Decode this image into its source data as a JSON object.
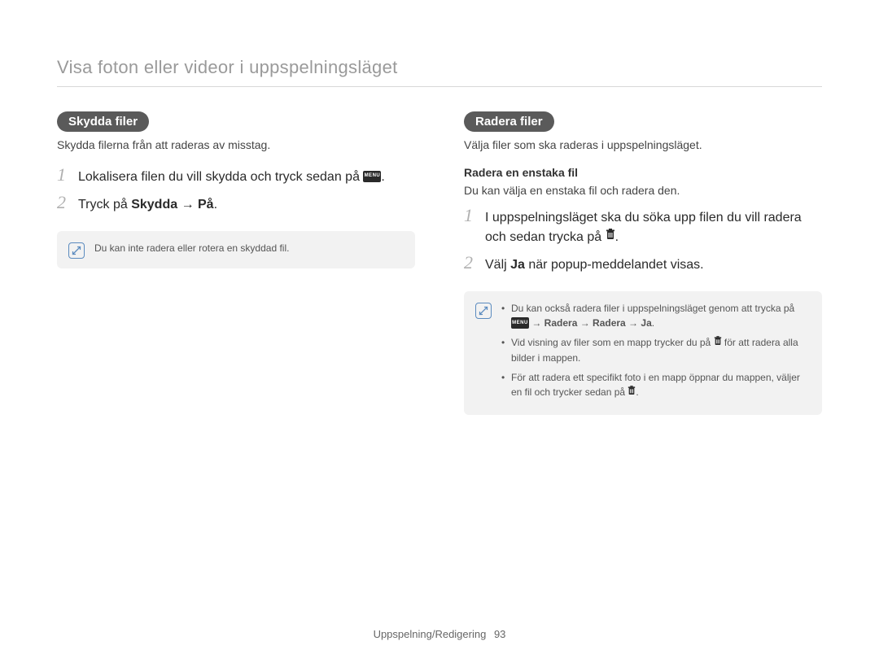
{
  "header": "Visa foton eller videor i uppspelningsläget",
  "left": {
    "pill": "Skydda filer",
    "intro": "Skydda filerna från att raderas av misstag.",
    "step1_pre": "Lokalisera filen du vill skydda och tryck sedan på ",
    "step1_post": ".",
    "step2_pre": "Tryck på ",
    "step2_bold": "Skydda → På",
    "step2_post": ".",
    "note": "Du kan inte radera eller rotera en skyddad fil."
  },
  "right": {
    "pill": "Radera filer",
    "intro": "Välja filer som ska raderas i uppspelningsläget.",
    "subhead": "Radera en enstaka fil",
    "body": "Du kan välja en enstaka fil och radera den.",
    "step1_a": "I uppspelningsläget ska du söka upp filen du vill radera och sedan trycka på ",
    "step1_b": ".",
    "step2_pre": "Välj ",
    "step2_bold": "Ja",
    "step2_post": " när popup-meddelandet visas.",
    "notes": {
      "n1_pre": "Du kan också radera filer i uppspelningsläget genom att trycka på ",
      "n1_bold": " → Radera → Radera → Ja",
      "n1_post": ".",
      "n2_pre": "Vid visning av filer som en mapp trycker du på ",
      "n2_post": " för att radera alla bilder i mappen.",
      "n3_pre": "För att radera ett specifikt foto i en mapp öppnar du mappen, väljer en fil och trycker sedan på ",
      "n3_post": "."
    }
  },
  "icons": {
    "menu_label": "MENU"
  },
  "footer": {
    "section": "Uppspelning/Redigering",
    "page": "93"
  }
}
